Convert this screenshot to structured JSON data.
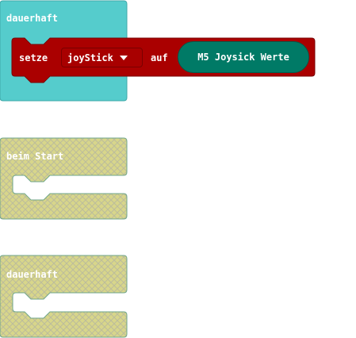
{
  "colors": {
    "loop_block": "#55cccc",
    "set_block": "#aa0000",
    "dropdown": "#a80000",
    "reporter": "#007a66",
    "disabled_fill": "#d8d68a",
    "disabled_hatch": "#bcbc9c"
  },
  "blocks": {
    "forever_active": {
      "label": "dauerhaft"
    },
    "set_statement": {
      "keyword": "setze",
      "variable": "joyStick",
      "connector": "auf",
      "value": "M5 Joysick Werte"
    },
    "on_start_disabled": {
      "label": "beim Start"
    },
    "forever_disabled": {
      "label": "dauerhaft"
    }
  }
}
